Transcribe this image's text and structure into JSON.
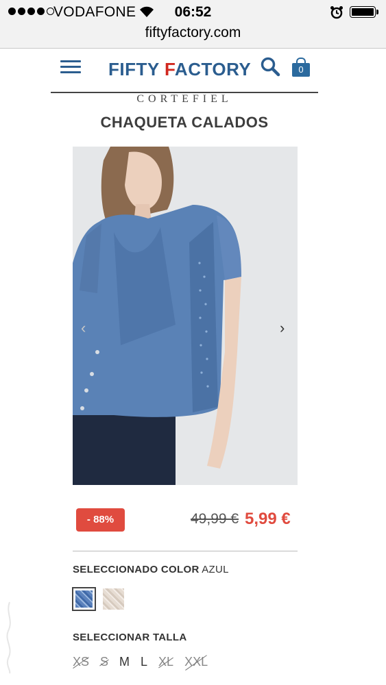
{
  "status_bar": {
    "carrier": "VODAFONE",
    "time": "06:52",
    "signal_bars_filled": 4,
    "signal_bars_total": 5,
    "battery_level": 1.0,
    "icons": [
      "signal-dots-icon",
      "wifi-icon",
      "alarm-icon",
      "battery-icon"
    ]
  },
  "browser": {
    "url": "fiftyfactory.com"
  },
  "header": {
    "logo_part1": "FIFTY ",
    "logo_part2": "F",
    "logo_part3": "ACTORY",
    "cart_count": "0",
    "icons": [
      "menu-icon",
      "search-icon",
      "shopping-bag-icon"
    ],
    "colors": {
      "blue": "#2b5d8f",
      "red": "#d1281f"
    }
  },
  "product": {
    "brand": "CORTEFIEL",
    "name": "CHAQUETA CALADOS",
    "discount": "- 88%",
    "old_price": "49,99 €",
    "new_price": "5,99 €",
    "color_heading": "SELECCIONADO COLOR",
    "color_value": "AZUL",
    "size_heading": "SELECCIONAR TALLA",
    "sizes": [
      {
        "label": "XS",
        "available": false
      },
      {
        "label": "S",
        "available": false
      },
      {
        "label": "M",
        "available": true
      },
      {
        "label": "L",
        "available": true
      },
      {
        "label": "XL",
        "available": false
      },
      {
        "label": "XXL",
        "available": false
      }
    ],
    "swatch_colors": [
      "#5b82bd",
      "#e6dcd2"
    ],
    "accent_color": "#e04b3f"
  }
}
